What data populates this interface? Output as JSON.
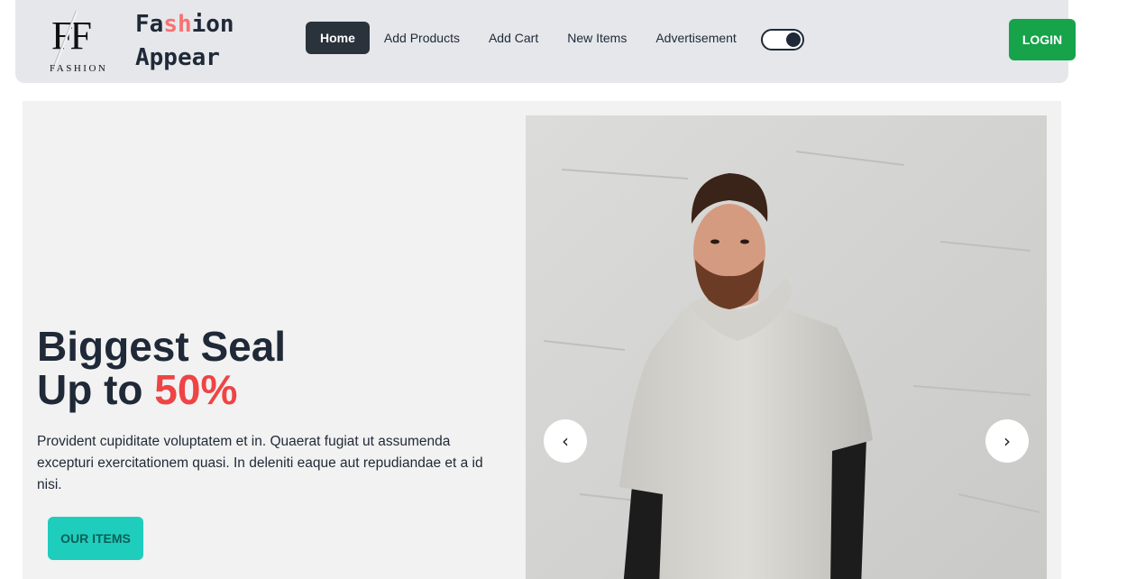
{
  "navbar": {
    "logo": {
      "mark": "FF",
      "word": "FASHION"
    },
    "brand": {
      "line1_a": "Fa",
      "line1_b": "sh",
      "line1_c": "ion",
      "line2": "Appear",
      "accent_color": "#f87171"
    },
    "links": [
      {
        "label": "Home",
        "active": true
      },
      {
        "label": "Add Products",
        "active": false
      },
      {
        "label": "Add Cart",
        "active": false
      },
      {
        "label": "New Items",
        "active": false
      },
      {
        "label": "Advertisement",
        "active": false
      }
    ],
    "theme_toggle": {
      "on": true
    },
    "login_label": "LOGIN",
    "login_color": "#16a34a"
  },
  "hero": {
    "title_line1": "Biggest Seal",
    "title_line2_prefix": "Up to ",
    "title_highlight": "50%",
    "highlight_color": "#ef4444",
    "description": "Provident cupiditate voluptatem et in. Quaerat fugiat ut assumenda excepturi exercitationem quasi. In deleniti eaque aut repudiandae et a id nisi.",
    "cta_label": "OUR ITEMS",
    "cta_color": "#1fcdbc"
  },
  "carousel": {
    "prev_label": "‹",
    "next_label": "›",
    "image_subject": "man in grey hoodie"
  }
}
